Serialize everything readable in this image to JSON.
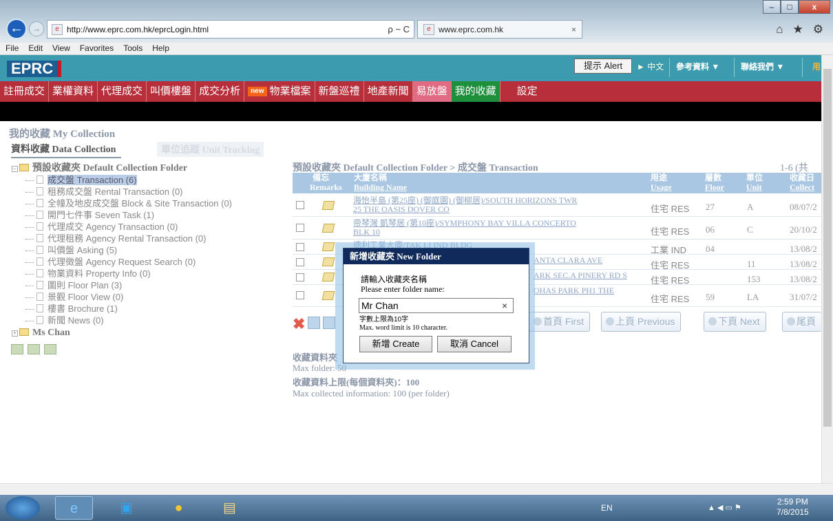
{
  "browser": {
    "address": "http://www.eprc.com.hk/eprcLogin.html",
    "address_tools": "ρ ~ C",
    "tab_title": "www.eprc.com.hk",
    "tab_close": "×",
    "win_min": "–",
    "win_max": "□",
    "win_close": "x",
    "back": "←",
    "forward": "→",
    "toolbar_icons": [
      "⌂",
      "★",
      "⚙"
    ]
  },
  "menubar": [
    "File",
    "Edit",
    "View",
    "Favorites",
    "Tools",
    "Help"
  ],
  "header": {
    "logo": "EPRC",
    "alert": "提示 Alert",
    "lang": "► 中文",
    "reference": "參考資料 ▼",
    "contact": "聯絡我們 ▼",
    "user": "用"
  },
  "nav": {
    "items": [
      "註冊成交",
      "業權資料",
      "代理成交",
      "叫價樓盤",
      "成交分析",
      "物業檔案",
      "新盤巡禮",
      "地產新聞",
      "易放盤",
      "我的收藏",
      "設定"
    ],
    "new_badge": "new"
  },
  "collection": {
    "title": "我的收藏 My Collection",
    "tab_data": "資料收藏 Data Collection",
    "tab_unit": "單位追蹤 Unit Tracking"
  },
  "tree": {
    "root": "預設收藏夾 Default Collection Folder",
    "items": [
      "成交盤 Transaction (6)",
      "租務成交盤 Rental Transaction (0)",
      "全幢及地皮成交盤 Block & Site Transaction (0)",
      "開門七件事 Seven Task (1)",
      "代理成交 Agency Transaction (0)",
      "代理租務 Agency Rental Transaction (0)",
      "叫價盤 Asking (5)",
      "代理徵盤 Agency Request Search (0)",
      "物業資料 Property Info (0)",
      "圖則 Floor Plan (3)",
      "景觀 Floor View (0)",
      "樓書 Brochure (1)",
      "新聞 News (0)"
    ],
    "user_folder": "Ms Chan"
  },
  "table": {
    "breadcrumb": "預設收藏夾 Default Collection Folder > 成交盤 Transaction",
    "count": "1-6 (共",
    "headers": {
      "remarks_zh": "備忘",
      "remarks_en": "Remarks",
      "building_zh": "大廈名稱",
      "building_en": "Building Name",
      "usage_zh": "用途",
      "usage_en": "Usage",
      "floor_zh": "層數",
      "floor_en": "Floor",
      "unit_zh": "單位",
      "unit_en": "Unit",
      "collect_zh": "收藏日",
      "collect_en": "Collect"
    },
    "rows": [
      {
        "name1": "海怡半島 (第25座) (御庭園) (御柳居)/SOUTH HORIZONS TWR",
        "name2": "25 THE OASIS DOVER CO",
        "usage": "住宅 RES",
        "floor": "27",
        "unit": "A",
        "date": "08/07/2"
      },
      {
        "name1": "帝琴灣 凱琴居 (第10座)/SYMPHONY BAY VILLA CONCERTO",
        "name2": "BLK 10",
        "usage": "住宅 RES",
        "floor": "06",
        "unit": "C",
        "date": "20/10/2"
      },
      {
        "name1": "德利工業大廈/TAK LI IND BLDG",
        "name2": "",
        "usage": "工業 IND",
        "floor": "04",
        "unit": "",
        "date": "13/08/2"
      },
      {
        "name1": "ANTA CLARA AVE",
        "name2": "",
        "usage": "住宅 RES",
        "floor": "",
        "unit": "11",
        "date": "13/08/2"
      },
      {
        "name1": "ARK SEC.A PINERY RD S",
        "name2": "",
        "usage": "住宅 RES",
        "floor": "",
        "unit": "153",
        "date": "13/08/2"
      },
      {
        "name1": "OHAS PARK PH1 THE",
        "name2": "",
        "usage": "住宅 RES",
        "floor": "59",
        "unit": "LA",
        "date": "31/07/2"
      }
    ]
  },
  "pagination": {
    "first": "首頁 First",
    "previous": "上頁 Previous",
    "next": "下頁 Next",
    "last": "尾頁"
  },
  "footer": {
    "max_folder_zh": "收藏資料夾",
    "max_folder_en": "Max folder: 50",
    "max_info_zh": "收藏資料上限(每個資料夾)：100",
    "max_info_en": "Max collected information: 100 (per folder)"
  },
  "dialog": {
    "title": "新增收藏夾 New Folder",
    "label_zh": "請輸入收藏夾名稱",
    "label_en": "Please enter folder name:",
    "input_value": "Mr Chan",
    "clear": "×",
    "limit_zh": "字數上限為10字",
    "limit_en": "Max. word limit is 10 character.",
    "create": "新增 Create",
    "cancel": "取消 Cancel"
  },
  "taskbar": {
    "lang": "EN",
    "time": "2:59 PM",
    "date": "7/8/2015",
    "tray": "▲ ◀ ▭ ⚑"
  }
}
